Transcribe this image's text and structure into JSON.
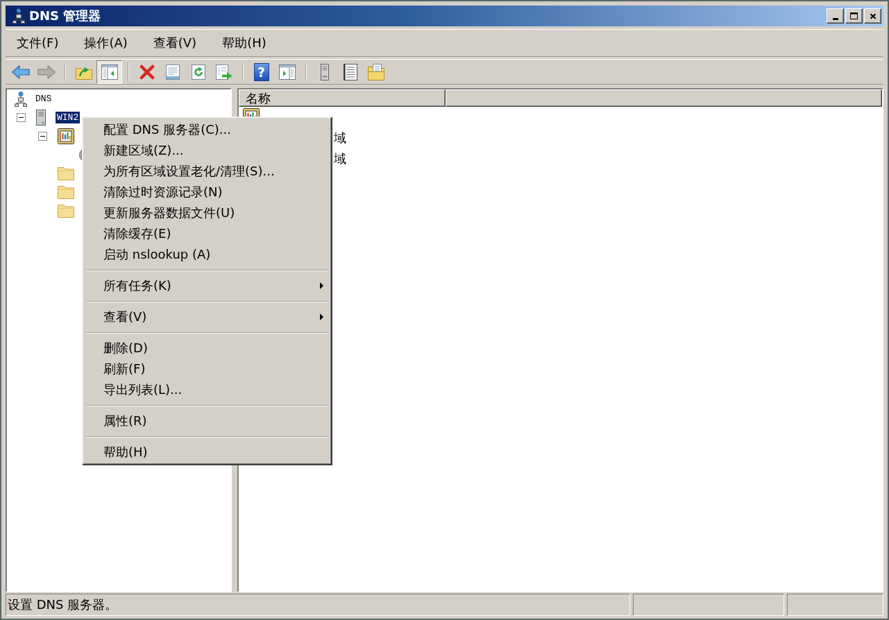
{
  "window": {
    "title": "DNS 管理器"
  },
  "menu_bar": [
    "文件(F)",
    "操作(A)",
    "查看(V)",
    "帮助(H)"
  ],
  "toolbar": [
    [
      {
        "kind": "back",
        "pressed": false,
        "disabled": false
      },
      {
        "kind": "forward",
        "pressed": false,
        "disabled": true
      }
    ],
    [
      {
        "kind": "up",
        "pressed": false,
        "disabled": false
      },
      {
        "kind": "tree",
        "pressed": true,
        "disabled": false
      }
    ],
    [
      {
        "kind": "delete",
        "pressed": false,
        "disabled": false
      },
      {
        "kind": "properties",
        "pressed": false,
        "disabled": false
      },
      {
        "kind": "refresh",
        "pressed": false,
        "disabled": false
      },
      {
        "kind": "export",
        "pressed": false,
        "disabled": false
      }
    ],
    [
      {
        "kind": "help",
        "glyph": "?",
        "pressed": false,
        "disabled": false
      },
      {
        "kind": "pane",
        "pressed": false,
        "disabled": false
      }
    ],
    [
      {
        "kind": "server",
        "pressed": false,
        "disabled": false
      },
      {
        "kind": "list",
        "pressed": false,
        "disabled": false
      },
      {
        "kind": "clipboard",
        "pressed": false,
        "disabled": false
      }
    ]
  ],
  "tree": [
    {
      "kind": "dns",
      "label": "DNS",
      "selected": false,
      "children": [
        {
          "kind": "server",
          "label": "WIN2",
          "selected": true,
          "expanded": true,
          "children": [
            {
              "kind": "log",
              "selected": false,
              "expanded": true,
              "children": [
                {
                  "kind": "event",
                  "selected": false
                }
              ]
            },
            {
              "kind": "folder",
              "selected": false
            },
            {
              "kind": "folder",
              "selected": false
            },
            {
              "kind": "folder",
              "selected": false
            }
          ]
        }
      ]
    }
  ],
  "list": {
    "columns": [
      "名称"
    ],
    "rows": [
      {
        "kind": "log"
      },
      {
        "name": "域"
      },
      {
        "name": "域"
      }
    ]
  },
  "context_menu": [
    {
      "kind": "item",
      "label": "配置 DNS 服务器(C)..."
    },
    {
      "kind": "item",
      "label": "新建区域(Z)..."
    },
    {
      "kind": "item",
      "label": "为所有区域设置老化/清理(S)..."
    },
    {
      "kind": "item",
      "label": "清除过时资源记录(N)"
    },
    {
      "kind": "item",
      "label": "更新服务器数据文件(U)"
    },
    {
      "kind": "item",
      "label": "清除缓存(E)"
    },
    {
      "kind": "item",
      "label": "启动 nslookup (A)"
    },
    {
      "kind": "separator"
    },
    {
      "kind": "submenu",
      "label": "所有任务(K)"
    },
    {
      "kind": "separator"
    },
    {
      "kind": "submenu",
      "label": "查看(V)"
    },
    {
      "kind": "separator"
    },
    {
      "kind": "item",
      "label": "删除(D)"
    },
    {
      "kind": "item",
      "label": "刷新(F)"
    },
    {
      "kind": "item",
      "label": "导出列表(L)..."
    },
    {
      "kind": "separator"
    },
    {
      "kind": "item",
      "label": "属性(R)"
    },
    {
      "kind": "separator"
    },
    {
      "kind": "item",
      "label": "帮助(H)"
    }
  ],
  "status_bar": {
    "text": "设置 DNS 服务器。"
  }
}
